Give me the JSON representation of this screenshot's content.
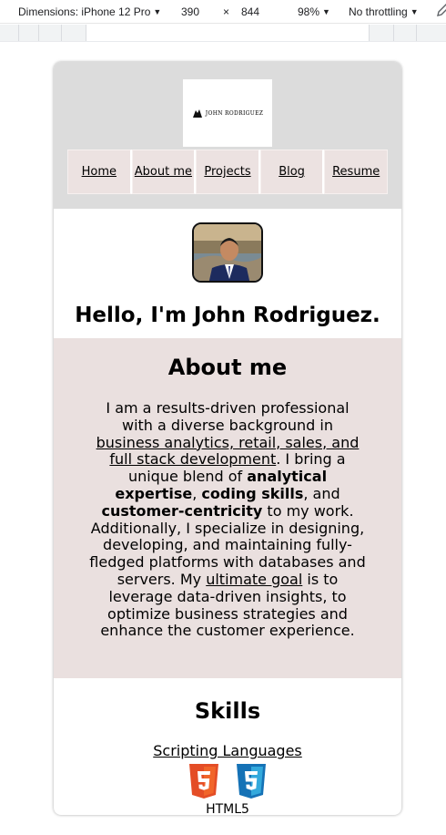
{
  "devtools": {
    "dimensions_label": "Dimensions: iPhone 12 Pro",
    "width": "390",
    "times": "×",
    "height": "844",
    "zoom": "98%",
    "throttling": "No throttling"
  },
  "header": {
    "logo_text": "JOHN RODRIGUEZ",
    "nav": [
      "Home",
      "About me",
      "Projects",
      "Blog",
      "Resume"
    ]
  },
  "hero": {
    "greeting": "Hello, I'm John Rodriguez."
  },
  "about": {
    "title": "About me",
    "p1": "I am a results-driven professional with a diverse background in ",
    "link1": "business analytics, retail, sales, and full stack development",
    "p2": ". I bring a unique blend of ",
    "b1": "analytical expertise",
    "p3": ", ",
    "b2": "coding skills",
    "p4": ", and ",
    "b3": "customer-centricity",
    "p5": " to my work. Additionally, I specialize in designing, developing, and maintaining fully-fledged platforms with databases and servers. My ",
    "link2": "ultimate goal",
    "p6": " is to leverage data-driven insights, to optimize business strategies and enhance the customer experience."
  },
  "skills": {
    "title": "Skills",
    "category_link": "Scripting Languages",
    "icons": [
      "html5-icon",
      "css3-icon"
    ],
    "first_label": "HTML5"
  },
  "colors": {
    "header_bg": "#dcdcdc",
    "nav_bg": "#ece2e1",
    "about_bg": "#eae0df",
    "html5_orange": "#e44d26",
    "css3_blue": "#1572b6"
  }
}
